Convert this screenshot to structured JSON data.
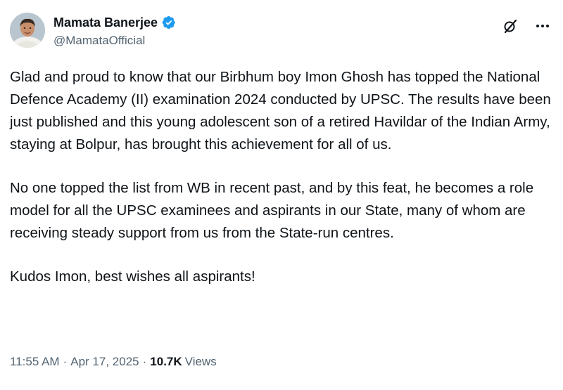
{
  "author": {
    "display_name": "Mamata Banerjee",
    "handle": "@MamataOfficial",
    "verified_color": "#1d9bf0"
  },
  "actions": {
    "grok_icon": "grok-icon",
    "more_icon": "more-icon"
  },
  "post": {
    "paragraphs": [
      "Glad and proud to know that our Birbhum boy Imon Ghosh has topped the National Defence Academy (II) examination 2024 conducted by UPSC. The results have been just published and this young adolescent son of a retired Havildar of the Indian Army, staying at Bolpur, has brought this achievement for all of us.",
      "No one topped the list from WB in recent past, and by this feat, he becomes a role model for all the UPSC examinees and aspirants in our State, many of whom are receiving steady support from us from the State-run centres.",
      "Kudos Imon, best wishes all aspirants!"
    ]
  },
  "meta": {
    "time": "11:55 AM",
    "separator": "·",
    "date": "Apr 17, 2025",
    "views_count": "10.7K",
    "views_label": "Views"
  }
}
